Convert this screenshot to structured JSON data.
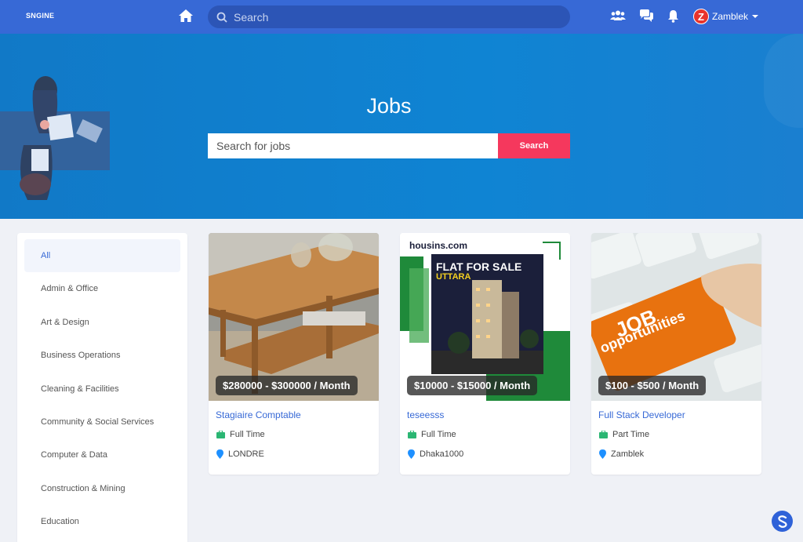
{
  "navbar": {
    "logo": "SNGINE",
    "search_placeholder": "Search",
    "user": {
      "name": "Zamblek",
      "avatar_letter": "Z"
    },
    "icons": [
      "home-icon",
      "search-icon",
      "friends-icon",
      "messages-icon",
      "notifications-icon",
      "caret-down-icon"
    ]
  },
  "hero": {
    "title": "Jobs",
    "search_placeholder": "Search for jobs",
    "search_button": "Search"
  },
  "sidebar": {
    "categories": [
      {
        "label": "All",
        "active": true
      },
      {
        "label": "Admin & Office"
      },
      {
        "label": "Art & Design"
      },
      {
        "label": "Business Operations"
      },
      {
        "label": "Cleaning & Facilities"
      },
      {
        "label": "Community & Social Services"
      },
      {
        "label": "Computer & Data"
      },
      {
        "label": "Construction & Mining"
      },
      {
        "label": "Education"
      }
    ]
  },
  "jobs": [
    {
      "price": "$280000 - $300000 / Month",
      "title": "Stagiaire Comptable",
      "type": "Full Time",
      "location": "LONDRE",
      "image": "wooden coffee table"
    },
    {
      "price": "$10000 - $15000 / Month",
      "title": "teseesss",
      "type": "Full Time",
      "location": "Dhaka1000",
      "image": "flat for sale ad",
      "image_text": {
        "brand": "housins.com",
        "headline": "FLAT FOR SALE",
        "subline": "UTTARA"
      }
    },
    {
      "price": "$100 - $500 / Month",
      "title": "Full Stack Developer",
      "type": "Part Time",
      "location": "Zamblek",
      "image": "job opportunities keyboard",
      "image_text": {
        "line1": "JOB",
        "line2": "opportunities"
      }
    }
  ],
  "colors": {
    "primary": "#3769d6",
    "hero": "#0f84d3",
    "accent": "#f5385d",
    "type_icon": "#2bb673",
    "location_icon": "#1e90ff"
  }
}
